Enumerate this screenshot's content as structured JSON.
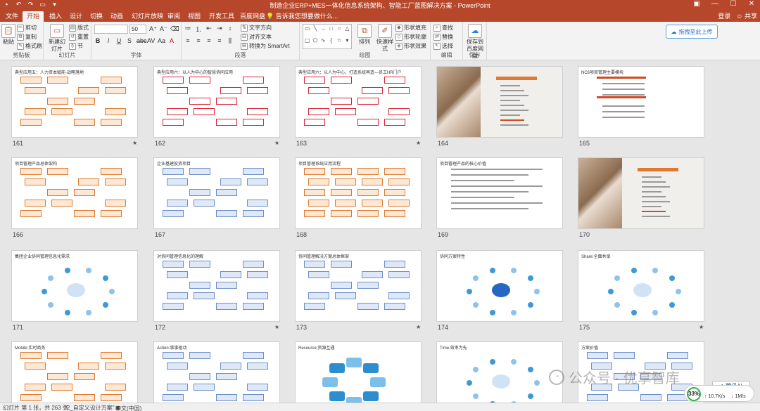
{
  "window": {
    "title": "制造企业ERP+MES一体化信息系统架构、智能工厂蓝图解决方案 - PowerPoint",
    "accent_color": "#b7472a",
    "qat_icons": [
      "save-icon",
      "undo-icon",
      "redo-icon",
      "slideshow-icon",
      "customize-icon"
    ]
  },
  "tabs": [
    "文件",
    "开始",
    "插入",
    "设计",
    "切换",
    "动画",
    "幻灯片放映",
    "审阅",
    "视图",
    "开发工具",
    "百度网盘"
  ],
  "active_tab": "开始",
  "tell_me": "告诉我您想要做什么...",
  "account": {
    "login": "登录",
    "share": "共享"
  },
  "ribbon": {
    "clipboard": {
      "label": "剪贴板",
      "paste": "粘贴",
      "cut": "剪切",
      "copy": "复制",
      "format_painter": "格式刷"
    },
    "slides": {
      "label": "幻灯片",
      "new_slide": "新建幻灯片",
      "layout": "版式",
      "reset": "重置",
      "section": "节"
    },
    "font": {
      "label": "字体",
      "size": "50"
    },
    "paragraph": {
      "label": "段落",
      "text_direction": "文字方向",
      "align_text": "对齐文本",
      "smartart": "转换为 SmartArt"
    },
    "drawing": {
      "label": "绘图",
      "arrange": "排列",
      "quick_styles": "快速样式",
      "shape_fill": "形状填充",
      "shape_outline": "形状轮廓",
      "shape_effects": "形状效果"
    },
    "editing": {
      "label": "编辑",
      "find": "查找",
      "replace": "替换",
      "select": "选择"
    },
    "save": {
      "label": "保存",
      "save_to_baidu": "保存到百度网盘"
    },
    "upload": "拖拽至此上传"
  },
  "slides": [
    {
      "num": "161",
      "title": "典型应用五：人力资本赋能-战略落地",
      "star": true,
      "kind": "pyramid"
    },
    {
      "num": "162",
      "title": "典型应用六：以人为中心的智慧协同应用",
      "star": true,
      "kind": "screens"
    },
    {
      "num": "163",
      "title": "典型应用六：以人为中心，打造系统再造—员工HR门户",
      "star": true,
      "kind": "portal"
    },
    {
      "num": "164",
      "title": "",
      "star": false,
      "kind": "photo"
    },
    {
      "num": "165",
      "title": "NC6项目管理主要模块",
      "star": false,
      "kind": "text"
    },
    {
      "num": "166",
      "title": "项目管理产品总体架构",
      "star": false,
      "kind": "arch"
    },
    {
      "num": "167",
      "title": "企业基建投资项目",
      "star": false,
      "kind": "flow"
    },
    {
      "num": "168",
      "title": "项目管理系统应用流程",
      "star": false,
      "kind": "process"
    },
    {
      "num": "169",
      "title": "项目管理产品的核心价值",
      "star": false,
      "kind": "bullets"
    },
    {
      "num": "170",
      "title": "",
      "star": false,
      "kind": "photo"
    },
    {
      "num": "171",
      "title": "集团企业协同管理信息化需求",
      "star": false,
      "kind": "hub"
    },
    {
      "num": "172",
      "title": "对协同管理信息化的理解",
      "star": true,
      "kind": "scroll"
    },
    {
      "num": "173",
      "title": "协同管理解决方案总体框架",
      "star": true,
      "kind": "framework"
    },
    {
      "num": "174",
      "title": "协同方案特性",
      "star": false,
      "kind": "cloud"
    },
    {
      "num": "175",
      "title": "Share:全面共享",
      "star": true,
      "kind": "share"
    },
    {
      "num": "",
      "title": "Mobile:实时商务",
      "star": false,
      "kind": "mobile"
    },
    {
      "num": "",
      "title": "Action:事事驱动",
      "star": false,
      "kind": "action"
    },
    {
      "num": "",
      "title": "Resource:资源互通",
      "star": false,
      "kind": "wheel"
    },
    {
      "num": "",
      "title": "Time:效率为先",
      "star": false,
      "kind": "ring"
    },
    {
      "num": "",
      "title": "方案价值",
      "star": false,
      "kind": "value"
    }
  ],
  "status": {
    "slide_info": "幻灯片 第 1 张，共 263 张",
    "theme": "\"2_自定义设计方案\"",
    "language": "中文(中国)"
  },
  "watermark": "公众号 · 优享智库",
  "ai_badge": "腾讯AI",
  "net": {
    "cpu_percent": "33%",
    "upload": "10.7K/s",
    "download": "1M/s"
  }
}
